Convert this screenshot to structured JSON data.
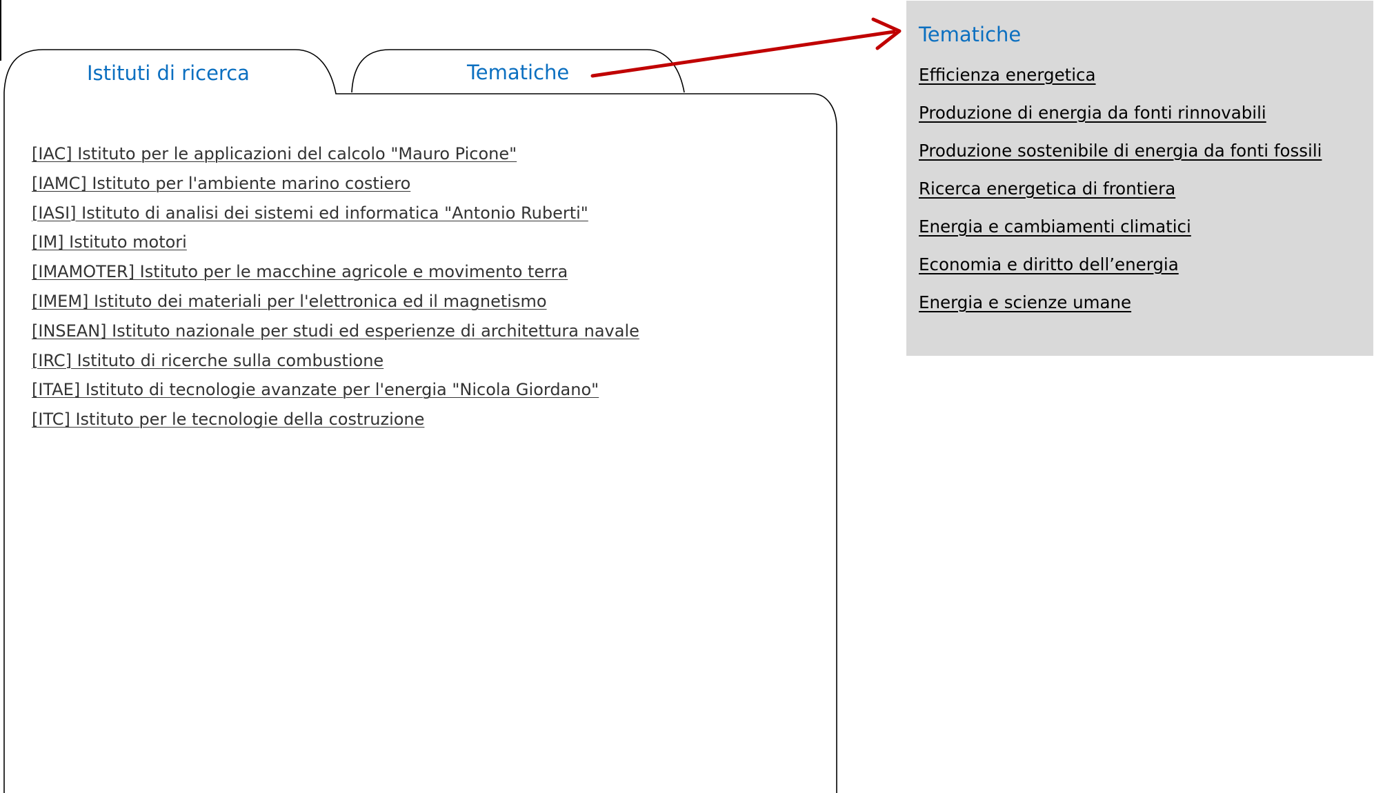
{
  "tabs": [
    {
      "label": "Istituti di ricerca"
    },
    {
      "label": "Tematiche"
    }
  ],
  "institutes": [
    "[IAC] Istituto per le applicazioni del calcolo \"Mauro Picone\"",
    "[IAMC] Istituto per l'ambiente marino costiero",
    "[IASI] Istituto di analisi dei sistemi ed informatica \"Antonio Ruberti\"",
    "[IM] Istituto motori",
    "[IMAMOTER] Istituto per le macchine agricole e movimento terra",
    "[IMEM] Istituto dei materiali per l'elettronica ed il magnetismo",
    "[INSEAN] Istituto nazionale per studi ed esperienze di architettura navale",
    "[IRC] Istituto di ricerche sulla combustione",
    "[ITAE] Istituto di tecnologie avanzate per l'energia \"Nicola Giordano\"",
    "[ITC] Istituto per le tecnologie della costruzione"
  ],
  "tematiche_panel": {
    "title": "Tematiche",
    "items": [
      "Efficienza energetica",
      "Produzione di energia da fonti rinnovabili",
      "Produzione sostenibile di energia da fonti fossili",
      "Ricerca energetica di frontiera",
      "Energia e cambiamenti climatici",
      "Economia e diritto dell’energia",
      "Energia e scienze umane"
    ]
  },
  "colors": {
    "tab_text": "#0b6fc0",
    "panel_bg": "#d9d9d9",
    "arrow": "#c00000",
    "outline": "#000000",
    "institute_link": "#333333",
    "tematiche_link": "#000000"
  }
}
